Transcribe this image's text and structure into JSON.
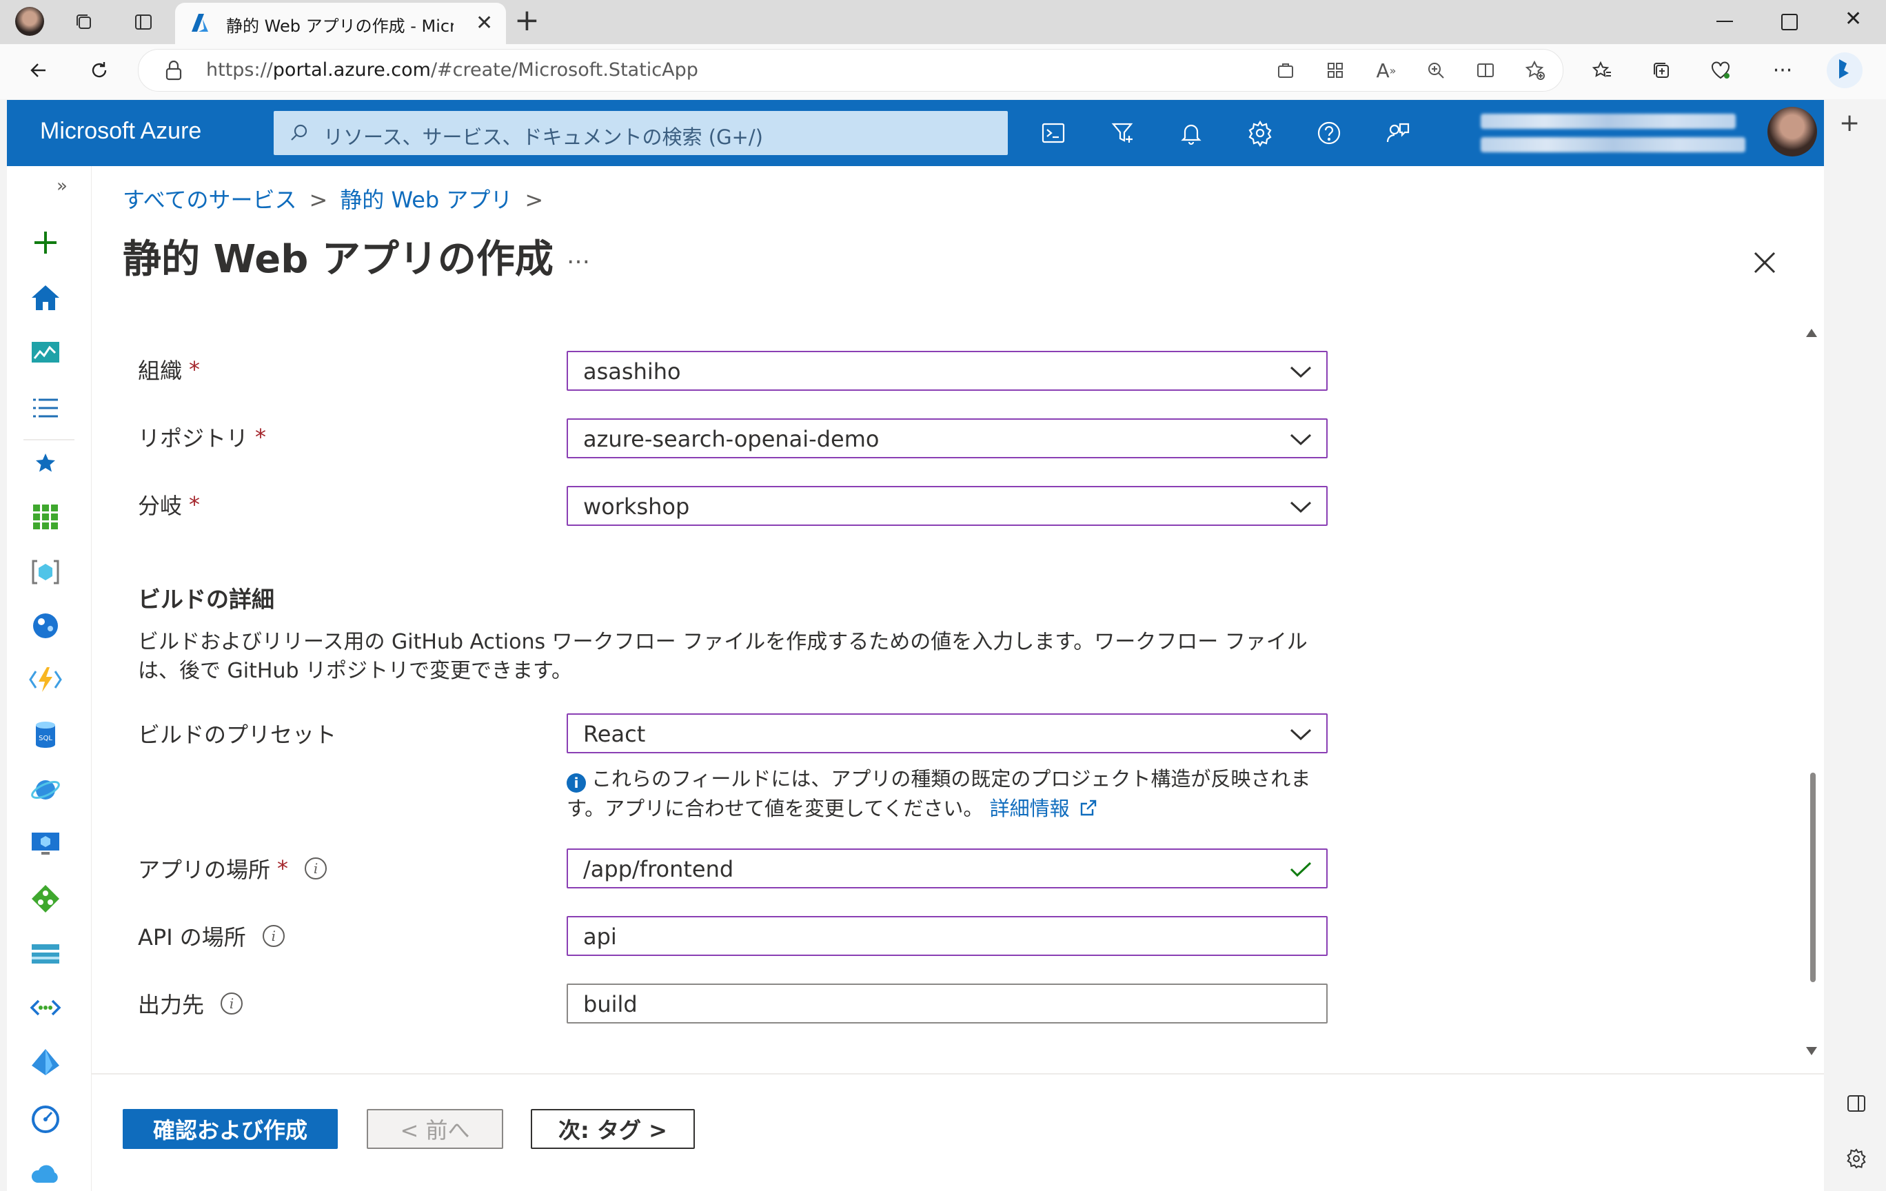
{
  "browser": {
    "tab_title": "静的 Web アプリの作成 - Microsoft Azure",
    "url": "https://portal.azure.com/#create/Microsoft.StaticApp",
    "url_prefix": "https://",
    "url_host": "portal.azure.com",
    "url_path": "/#create/Microsoft.StaticApp",
    "new_tab_label": "+",
    "window_controls": [
      "minimize",
      "restore",
      "close"
    ]
  },
  "azure_header": {
    "brand": "Microsoft Azure",
    "search_placeholder": "リソース、サービス、ドキュメントの検索 (G+/)",
    "icons": [
      "cloud-shell-icon",
      "directory-filter-icon",
      "notifications-icon",
      "settings-icon",
      "help-icon",
      "feedback-icon"
    ]
  },
  "breadcrumb": {
    "items": [
      "すべてのサービス",
      "静的 Web アプリ"
    ],
    "separator": ">"
  },
  "page": {
    "title": "静的 Web アプリの作成",
    "more": "…"
  },
  "form": {
    "organization": {
      "label": "組織",
      "required": "*",
      "value": "asashiho"
    },
    "repository": {
      "label": "リポジトリ",
      "required": "*",
      "value": "azure-search-openai-demo"
    },
    "branch": {
      "label": "分岐",
      "required": "*",
      "value": "workshop"
    },
    "build_details": {
      "heading": "ビルドの詳細",
      "description": "ビルドおよびリリース用の GitHub Actions ワークフロー ファイルを作成するための値を入力します。ワークフロー ファイルは、後で GitHub リポジトリで変更できます。"
    },
    "build_preset": {
      "label": "ビルドのプリセット",
      "value": "React",
      "note": "これらのフィールドには、アプリの種類の既定のプロジェクト構造が反映されます。アプリに合わせて値を変更してください。",
      "note_link": "詳細情報"
    },
    "app_location": {
      "label": "アプリの場所",
      "required": "*",
      "value": "/app/frontend"
    },
    "api_location": {
      "label": "API の場所",
      "value": "api"
    },
    "output_location": {
      "label": "出力先",
      "value": "build"
    }
  },
  "footer": {
    "create_button": "確認および作成",
    "prev_button": "< 前へ",
    "next_button": "次: タグ >"
  },
  "colors": {
    "azure_blue": "#0f6cbd",
    "field_border": "#8a3fb4",
    "required_red": "#a4262c",
    "valid_green": "#107c10"
  }
}
